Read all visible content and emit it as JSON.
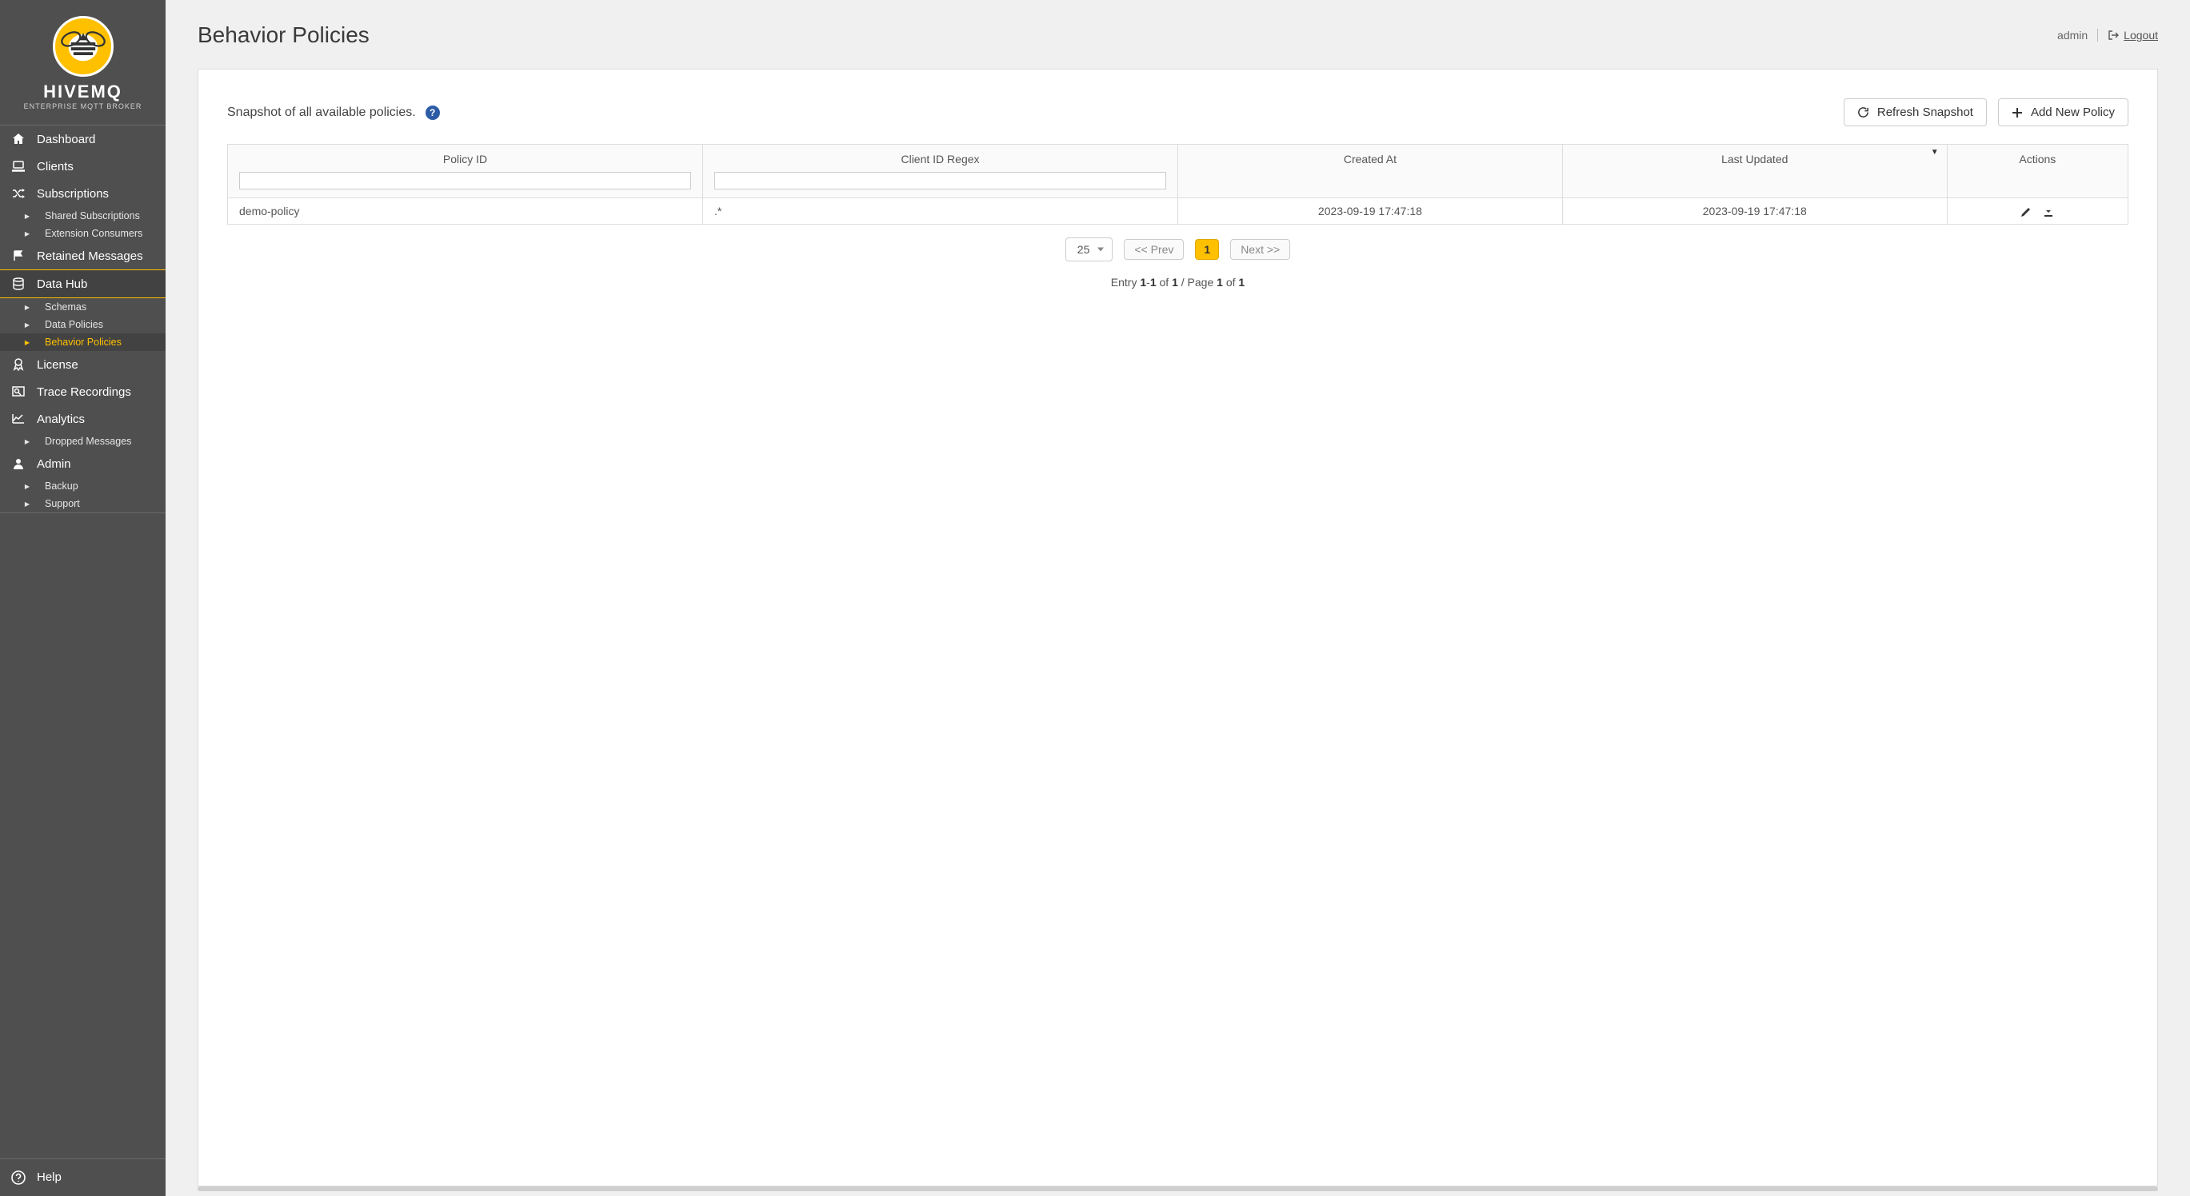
{
  "brand": {
    "name": "HIVEMQ",
    "sub": "ENTERPRISE MQTT BROKER"
  },
  "sidebar": {
    "dashboard": "Dashboard",
    "clients": "Clients",
    "subscriptions": "Subscriptions",
    "sub_shared": "Shared Subscriptions",
    "sub_ext": "Extension Consumers",
    "retained": "Retained Messages",
    "datahub": "Data Hub",
    "dh_schemas": "Schemas",
    "dh_data": "Data Policies",
    "dh_behavior": "Behavior Policies",
    "license": "License",
    "trace": "Trace Recordings",
    "analytics": "Analytics",
    "an_dropped": "Dropped Messages",
    "admin": "Admin",
    "ad_backup": "Backup",
    "ad_support": "Support",
    "help": "Help"
  },
  "header": {
    "title": "Behavior Policies",
    "user": "admin",
    "logout": "Logout"
  },
  "panel": {
    "snapshot_text": "Snapshot of all available policies.",
    "refresh": "Refresh Snapshot",
    "add": "Add New Policy"
  },
  "table": {
    "cols": {
      "policy_id": "Policy ID",
      "client_regex": "Client ID Regex",
      "created": "Created At",
      "updated": "Last Updated",
      "actions": "Actions"
    },
    "rows": [
      {
        "policy_id": "demo-policy",
        "client_regex": ".*",
        "created": "2023-09-19 17:47:18",
        "updated": "2023-09-19 17:47:18"
      }
    ]
  },
  "pager": {
    "size": "25",
    "prev": "<< Prev",
    "page": "1",
    "next": "Next >>"
  },
  "entry": {
    "prefix": "Entry ",
    "a": "1",
    "dash": "-",
    "b": "1",
    "of1": " of ",
    "c": "1",
    "page_sep": " / Page ",
    "d": "1",
    "of2": " of ",
    "e": "1"
  }
}
